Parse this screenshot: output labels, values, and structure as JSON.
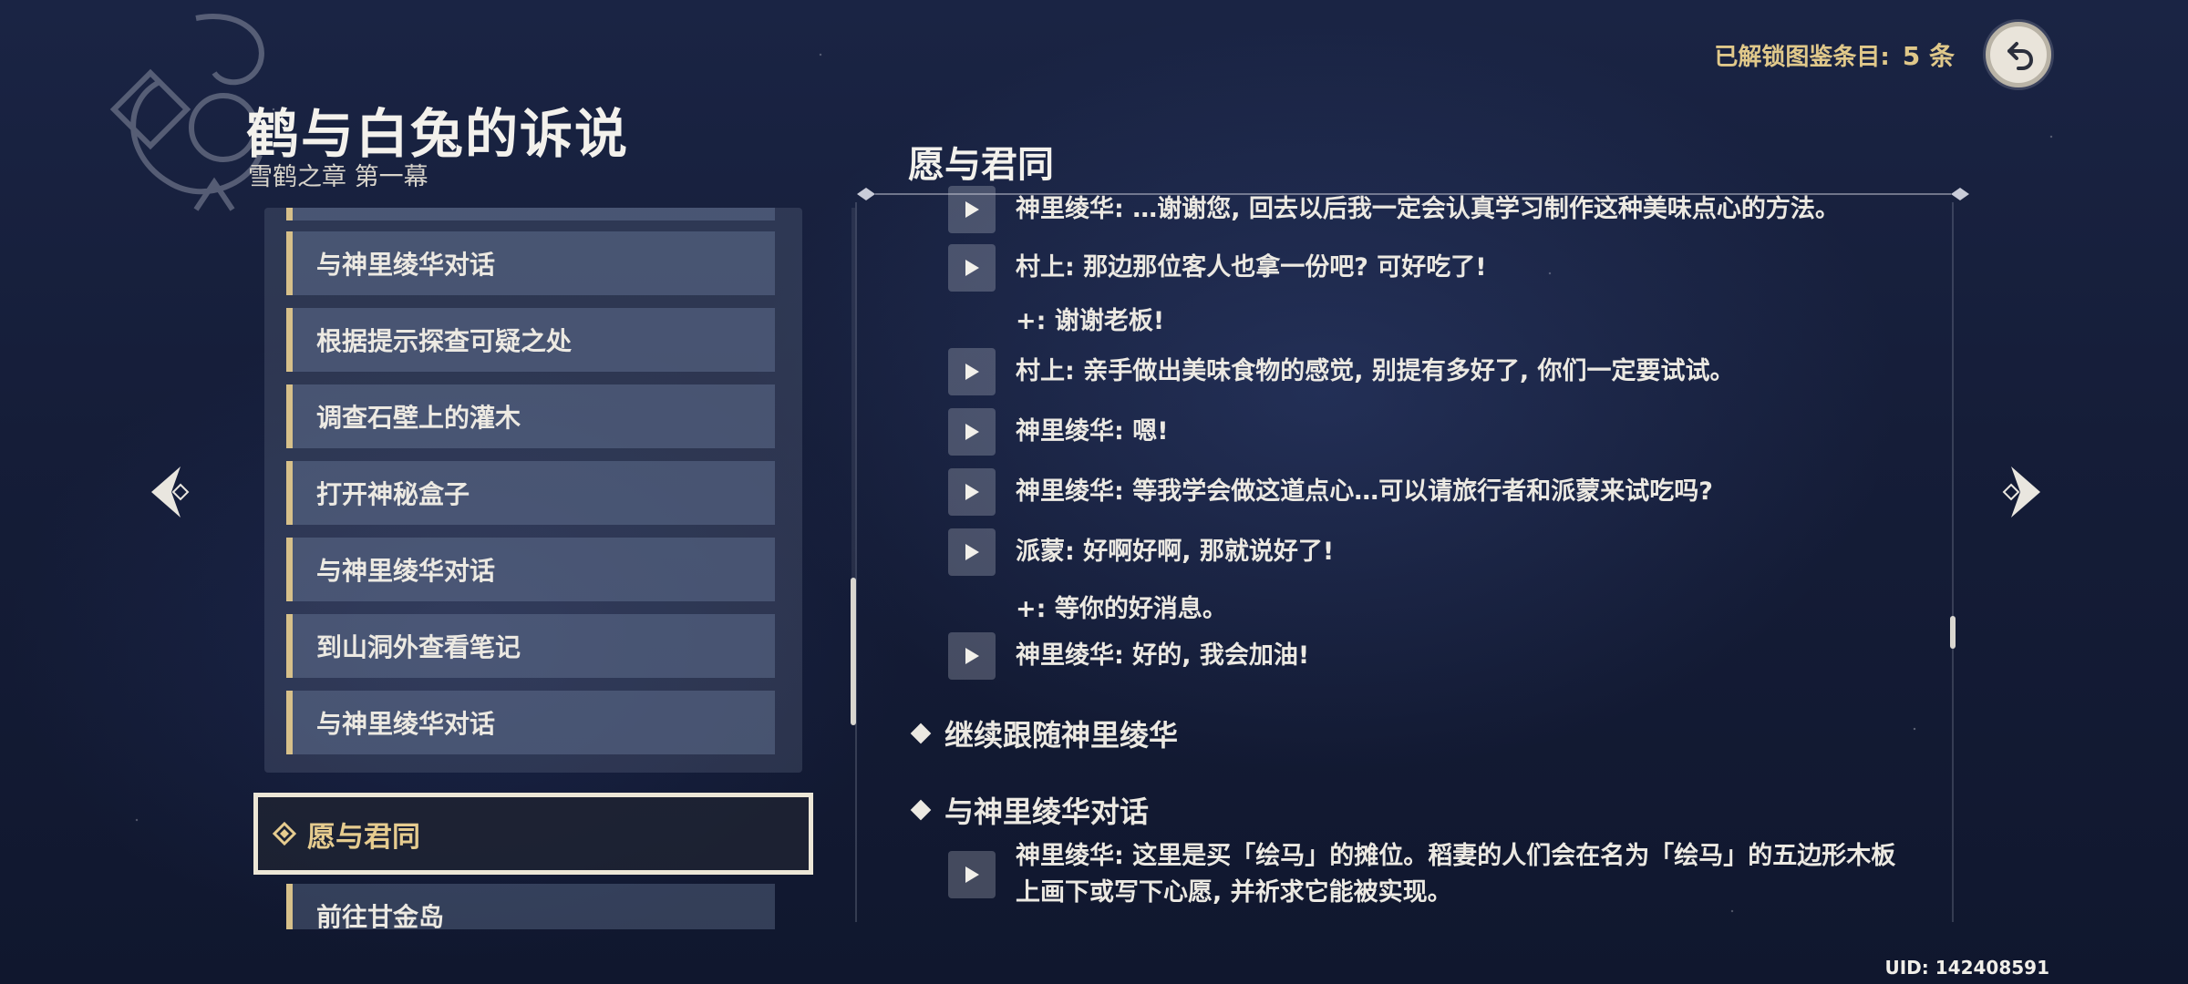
{
  "header": {
    "unlocked_label": "已解锁图鉴条目:",
    "unlocked_count": "5 条"
  },
  "chapter": {
    "title": "鹤与白兔的诉说",
    "subtitle": "雪鹤之章 第一幕"
  },
  "quest_list": {
    "items": [
      {
        "label": "与神里绫华对话"
      },
      {
        "label": "根据提示探查可疑之处"
      },
      {
        "label": "调查石壁上的灌木"
      },
      {
        "label": "打开神秘盒子"
      },
      {
        "label": "与神里绫华对话"
      },
      {
        "label": "到山洞外查看笔记"
      },
      {
        "label": "与神里绫华对话"
      }
    ],
    "selected": "愿与君同",
    "next": "前往甘金岛"
  },
  "detail": {
    "title": "愿与君同",
    "lines": [
      {
        "text": "神里绫华: …谢谢您, 回去以后我一定会认真学习制作这种美味点心的方法。"
      },
      {
        "text": "村上: 那边那位客人也拿一份吧? 可好吃了!"
      },
      {
        "reply": "+: 谢谢老板!"
      },
      {
        "text": "村上: 亲手做出美味食物的感觉, 别提有多好了, 你们一定要试试。"
      },
      {
        "text": "神里绫华: 嗯!"
      },
      {
        "text": "神里绫华: 等我学会做这道点心…可以请旅行者和派蒙来试吃吗?"
      },
      {
        "text": "派蒙: 好啊好啊, 那就说好了!"
      },
      {
        "reply": "+: 等你的好消息。"
      },
      {
        "text": "神里绫华: 好的, 我会加油!"
      }
    ],
    "steps": [
      {
        "label": "继续跟随神里绫华"
      },
      {
        "label": "与神里绫华对话"
      }
    ],
    "final_line_1": "神里绫华: 这里是买「绘马」的摊位。稻妻的人们会在名为「绘马」的五边形木板",
    "final_line_2": "上画下或写下心愿, 并祈求它能被实现。"
  },
  "uid": "UID: 142408591",
  "colors": {
    "accent_gold": "#d7c08a",
    "selected_text": "#e6cc8f"
  }
}
